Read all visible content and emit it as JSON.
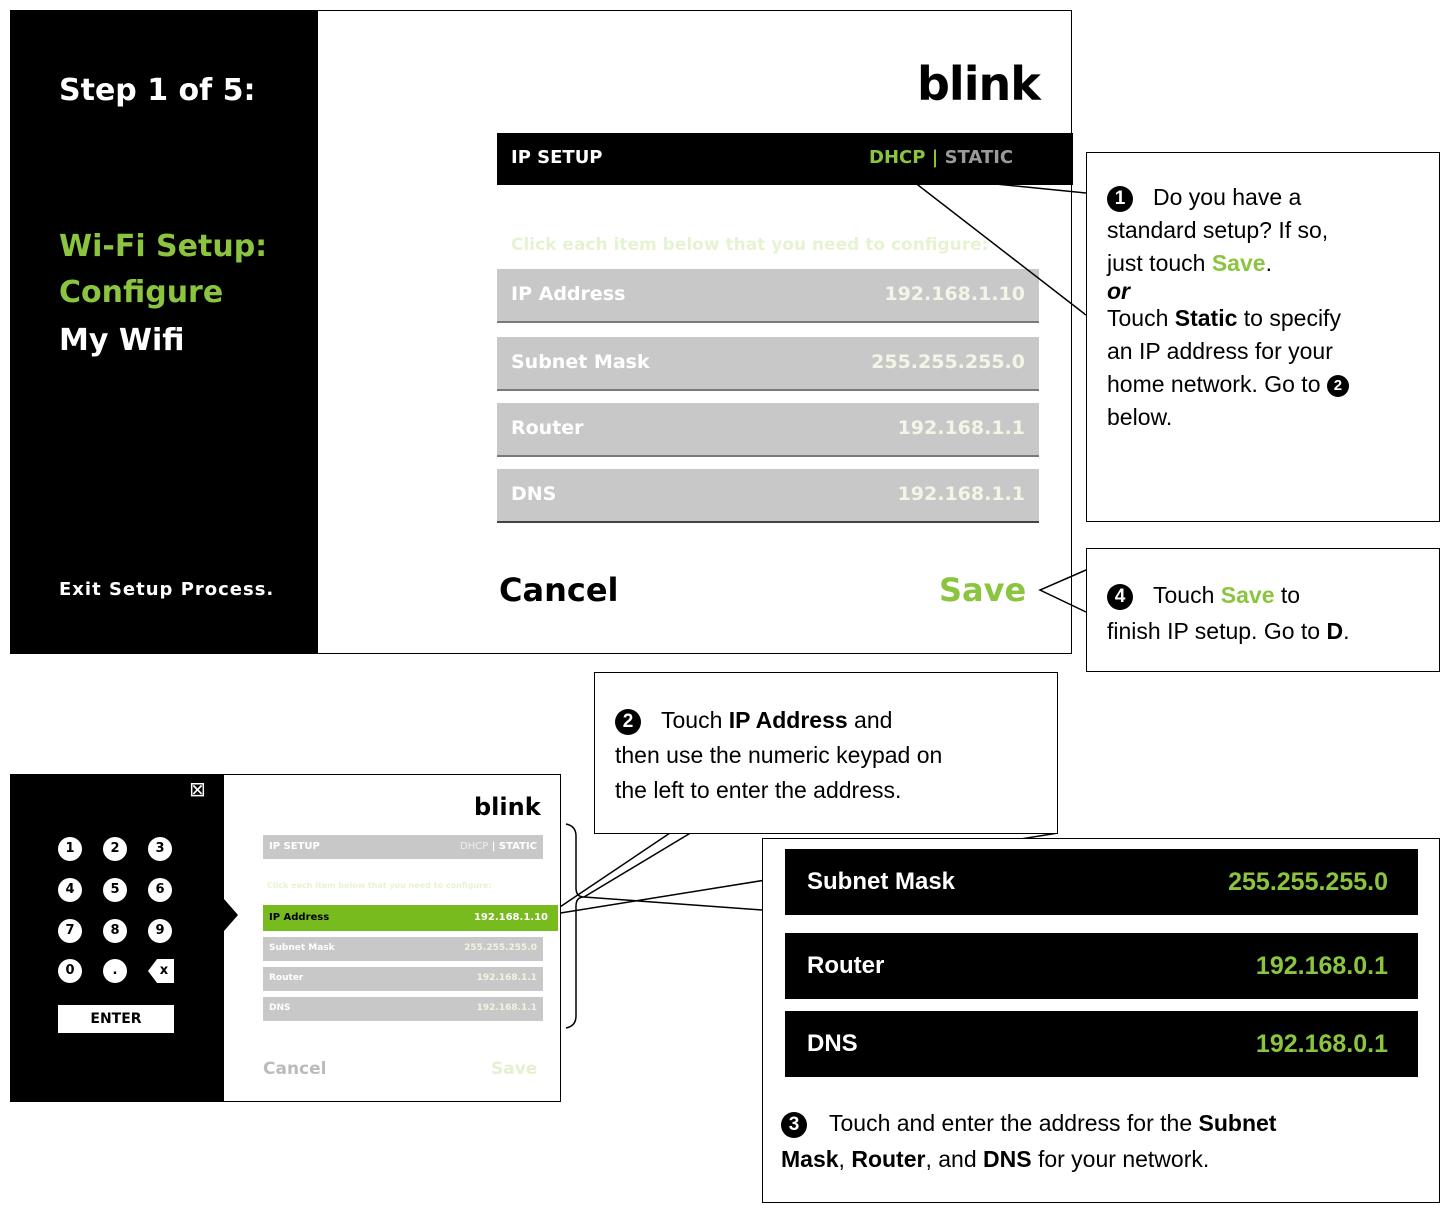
{
  "main_screen": {
    "step": "Step 1 of 5:",
    "section_title": "Wi-Fi Setup:",
    "section_sub": "Configure",
    "section_name": "My Wifi",
    "exit": "Exit Setup Process.",
    "logo": "blink",
    "ip_setup_label": "IP SETUP",
    "mode_dhcp": "DHCP",
    "mode_sep": "|",
    "mode_static": "STATIC",
    "hint": "Click each item below that you need to configure:",
    "rows": [
      {
        "label": "IP Address",
        "value": "192.168.1.10"
      },
      {
        "label": "Subnet Mask",
        "value": "255.255.255.0"
      },
      {
        "label": "Router",
        "value": "192.168.1.1"
      },
      {
        "label": "DNS",
        "value": "192.168.1.1"
      }
    ],
    "cancel": "Cancel",
    "save": "Save"
  },
  "callouts": {
    "c1": {
      "num": "1",
      "l1": "Do you have a",
      "l2": "standard setup? If so,",
      "l3a": "just touch ",
      "l3b": "Save",
      "l3c": ".",
      "or": "or",
      "l4a": "Touch ",
      "l4b": "Static",
      "l4c": " to specify",
      "l5": "an IP address for your",
      "l6": "home network. Go to",
      "l6num": "2",
      "l7": "below."
    },
    "c4": {
      "num": "4",
      "l1a": "Touch ",
      "l1b": "Save",
      "l1c": " to",
      "l2a": "finish IP setup. Go to ",
      "l2b": "D",
      "l2c": "."
    },
    "c2": {
      "num": "2",
      "l1a": "Touch ",
      "l1b": "IP Address",
      "l1c": " and",
      "l2": "then use the numeric keypad on",
      "l3": "the left to enter the address."
    },
    "c3": {
      "num": "3",
      "l1a": "Touch and enter the address for the ",
      "l1b": "Subnet",
      "l2a": "Mask",
      "l2b": ", ",
      "l2c": "Router",
      "l2d": ", and ",
      "l2e": "DNS",
      "l2f": " for your network."
    }
  },
  "small_screen": {
    "close_glyph": "⊠",
    "keys": [
      "1",
      "2",
      "3",
      "4",
      "5",
      "6",
      "7",
      "8",
      "9",
      "0",
      "."
    ],
    "backspace": "x",
    "enter": "ENTER",
    "logo": "blink",
    "ip_setup_label": "IP SETUP",
    "mode_dhcp": "DHCP",
    "mode_sep": "|",
    "mode_static": "STATIC",
    "hint": "Click each item below that you need to configure:",
    "rows": [
      {
        "label": "IP Address",
        "value": "192.168.1.10"
      },
      {
        "label": "Subnet Mask",
        "value": "255.255.255.0"
      },
      {
        "label": "Router",
        "value": "192.168.1.1"
      },
      {
        "label": "DNS",
        "value": "192.168.1.1"
      }
    ],
    "cancel": "Cancel",
    "save": "Save"
  },
  "zoom_panel": {
    "rows": [
      {
        "label": "Subnet Mask",
        "value": "255.255.255.0"
      },
      {
        "label": "Router",
        "value": "192.168.0.1"
      },
      {
        "label": "DNS",
        "value": "192.168.0.1"
      }
    ]
  },
  "colors": {
    "accent": "#8bc53f",
    "row_gray": "#c8c8c8",
    "black": "#000000"
  }
}
